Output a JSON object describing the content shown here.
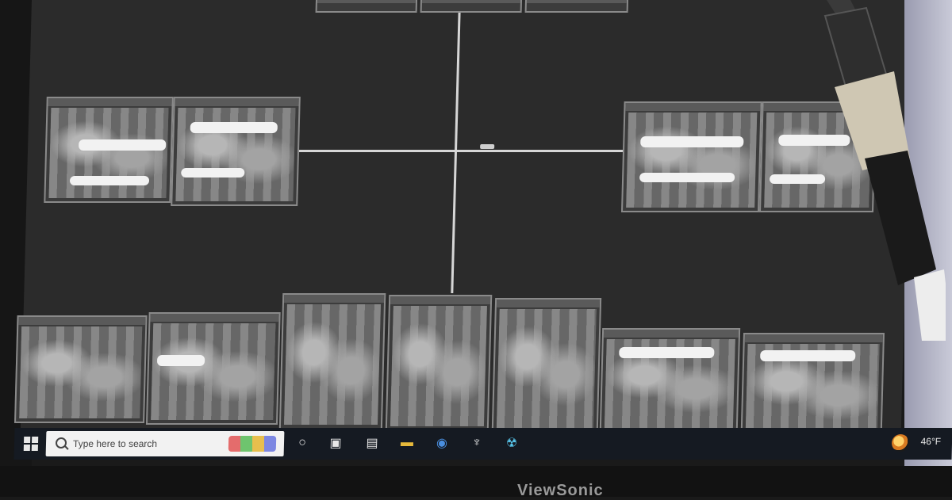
{
  "taskbar": {
    "search_placeholder": "Type here to search",
    "weather": "46°F"
  },
  "monitor": {
    "brand": "ViewSonic"
  },
  "xray_layout": {
    "top_row_count": 3,
    "left_bitewings": 2,
    "right_bitewings": 2,
    "bottom_periapicals": 7
  },
  "icons": {
    "start": "windows-logo-icon",
    "search": "magnifier-icon",
    "task_view": "task-view-icon",
    "widgets": "widgets-icon",
    "file_explorer": "file-explorer-icon",
    "browser": "browser-icon",
    "dental_app": "tooth-icon",
    "xray_app": "radiation-icon",
    "weather": "weather-icon"
  }
}
